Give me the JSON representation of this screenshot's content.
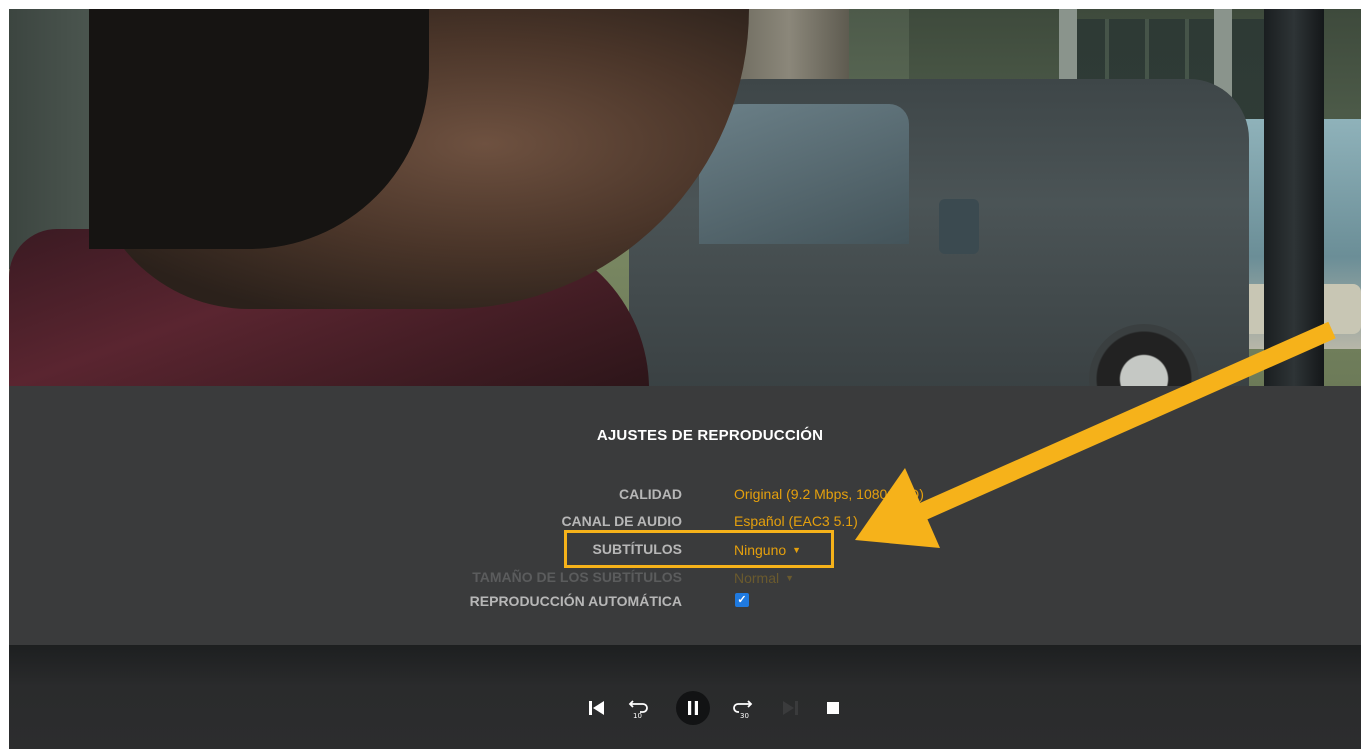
{
  "settings": {
    "title": "AJUSTES DE REPRODUCCIÓN",
    "rows": [
      {
        "label": "CALIDAD",
        "value": "Original (9.2 Mbps, 1080p HD)"
      },
      {
        "label": "CANAL DE AUDIO",
        "value": "Español (EAC3 5.1)"
      },
      {
        "label": "SUBTÍTULOS",
        "value": "Ninguno"
      },
      {
        "label": "TAMAÑO DE LOS SUBTÍTULOS",
        "value": "Normal"
      },
      {
        "label": "REPRODUCCIÓN AUTOMÁTICA",
        "checked": true
      }
    ]
  },
  "controls": {
    "icons": [
      "skip-previous-icon",
      "replay-10-icon",
      "pause-icon",
      "forward-30-icon",
      "skip-next-icon",
      "stop-icon"
    ]
  },
  "colors": {
    "accent": "#e5a00d",
    "annotation": "#f6b21a",
    "panel_bg": "#3a3b3c",
    "label": "#b7b7b7",
    "checkbox": "#1f7ae0"
  }
}
